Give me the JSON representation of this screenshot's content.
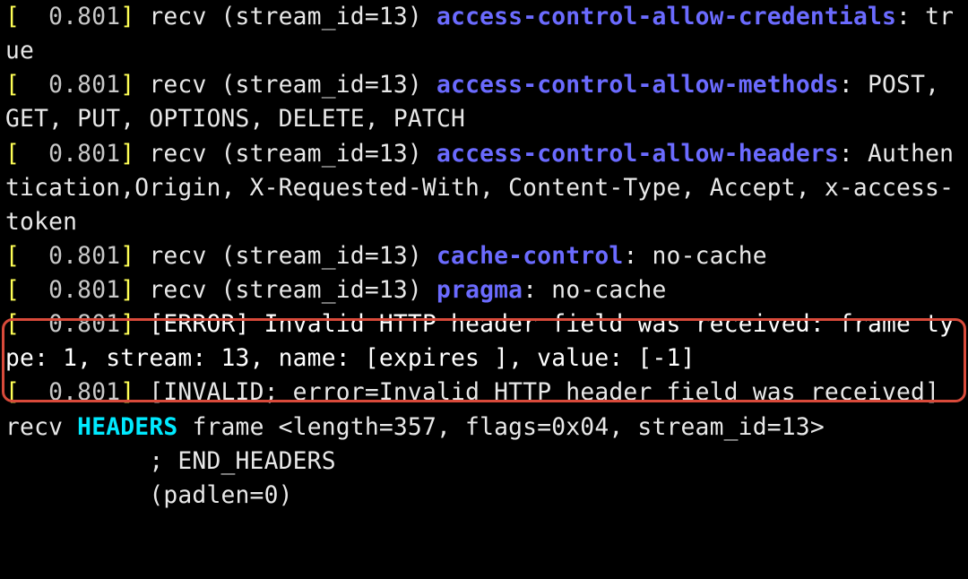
{
  "brackets": {
    "open": "[",
    "close": "]"
  },
  "ts": "  0.801",
  "lines": {
    "l1_prefix": " recv (stream_id=13) ",
    "l1_hdr": "access-control-allow-credentials",
    "l1_val": ": true",
    "l2_prefix": " recv (stream_id=13) ",
    "l2_hdr": "access-control-allow-methods",
    "l2_val": ": POST, GET, PUT, OPTIONS, DELETE, PATCH",
    "l3_prefix": " recv (stream_id=13) ",
    "l3_hdr": "access-control-allow-headers",
    "l3_val": ": Authentication,Origin, X-Requested-With, Content-Type, Accept, x-access-token",
    "l4_prefix": " recv (stream_id=13) ",
    "l4_hdr": "cache-control",
    "l4_val": ": no-cache",
    "l5_prefix": " recv (stream_id=13) ",
    "l5_hdr": "pragma",
    "l5_val": ": no-cache",
    "l6_err": " [ERROR] Invalid HTTP header field was received: frame type: 1, stream: 13, name: [expires ], value: [-1]",
    "l7_a": " [INVALID; error=Invalid HTTP header field was received] recv ",
    "l7_kw": "HEADERS",
    "l7_b": " frame <length=357, flags=0x04, stream_id=13>",
    "l8": "          ; END_HEADERS",
    "l9": "          (padlen=0)"
  }
}
